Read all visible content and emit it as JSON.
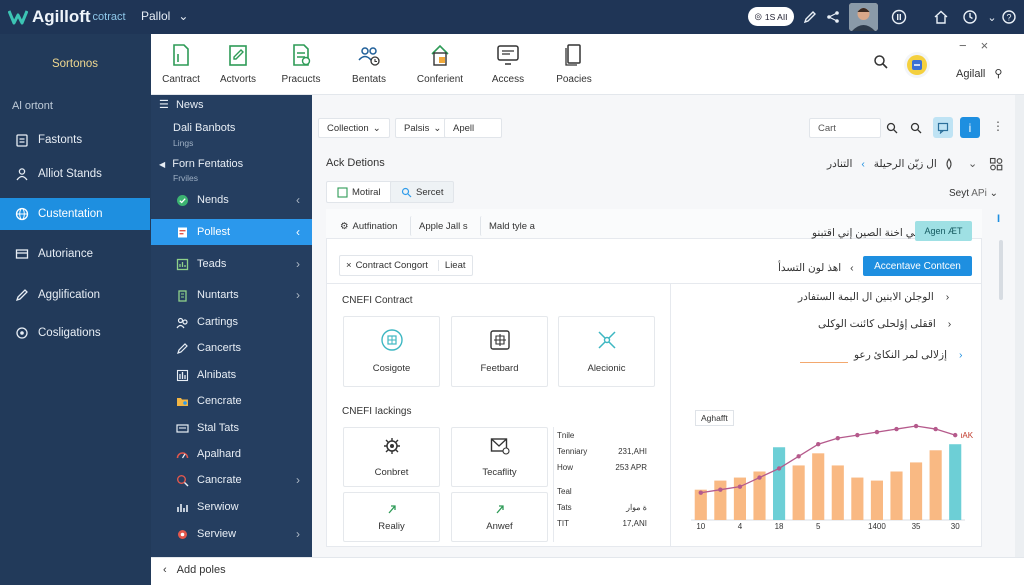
{
  "app": {
    "logo_text": "Agilloft",
    "logo_suffix": "cotract",
    "project": "Pallol",
    "pill": "1S AII",
    "user_label": "Agilall"
  },
  "left_nav": {
    "title": "Sortonos",
    "section": "Al ortont",
    "items": [
      {
        "label": "Fastonts",
        "icon": "clipboard-icon"
      },
      {
        "label": "Alliot Stands",
        "icon": "person-icon"
      },
      {
        "label": "Custentation",
        "icon": "globe-icon",
        "active": true
      },
      {
        "label": "Autoriance",
        "icon": "card-icon"
      },
      {
        "label": "Agglification",
        "icon": "pen-icon"
      },
      {
        "label": "Cosligations",
        "icon": "circle-icon"
      }
    ]
  },
  "ribbon": {
    "tabs": [
      {
        "label": "Cantract",
        "icon": "document-icon"
      },
      {
        "label": "Actvorts",
        "icon": "edit-document-icon"
      },
      {
        "label": "Pracucts",
        "icon": "doc-check-icon"
      },
      {
        "label": "Bentats",
        "icon": "users-clock-icon"
      },
      {
        "label": "Conferient",
        "icon": "doc-stamp-icon"
      },
      {
        "label": "Access",
        "icon": "monitor-icon"
      },
      {
        "label": "Poacies",
        "icon": "pages-icon"
      }
    ]
  },
  "sub_nav": {
    "header": "News",
    "groups": [
      {
        "title": "Dali Banbots",
        "sub": "Lings"
      },
      {
        "title": "Forn Fentatios",
        "sub": "Frviles"
      }
    ],
    "items": [
      {
        "label": "Nends"
      },
      {
        "label": "Pollest",
        "active": true
      },
      {
        "label": "Teads"
      },
      {
        "label": "Nuntarts"
      },
      {
        "label": "Cartings"
      },
      {
        "label": "Cancerts"
      },
      {
        "label": "Alnibats"
      },
      {
        "label": "Cencrate"
      },
      {
        "label": "Stal Tats"
      },
      {
        "label": "Apalhard"
      },
      {
        "label": "Cancrate"
      },
      {
        "label": "Serwiow"
      },
      {
        "label": "Serview"
      }
    ]
  },
  "toolbar": {
    "filter1": "Collection",
    "filter2": "Palsis",
    "filter3": "Apell",
    "search_placeholder": "Cart"
  },
  "main": {
    "heading": "Ack Detions",
    "rtl_breadcrumb1": "ال زيّن الرحيلة",
    "rtl_breadcrumb2": "التنادر",
    "btn_modal": "Motiral",
    "btn_search": "Sercet",
    "sort_label": "Seyt",
    "sort_value": "APi",
    "tabs": [
      "Autfination",
      "Apple Jall s",
      "Mald tyle a"
    ],
    "rtl_title": "افتي  اخنة الصين إني",
    "rtl_title_tail": "اقتبنو",
    "badge_teal": "Agen ÆT",
    "filter_tag": "Contract Congort",
    "filter_tag2": "Lieat",
    "rtl_mid": "اهذ لون التسدأ",
    "badge_blue": "Accentave Contcen",
    "section1": "CNEFI Contract",
    "tiles1": [
      {
        "label": "Cosigote",
        "icon": "grid-icon"
      },
      {
        "label": "Feetbard",
        "icon": "frame-icon"
      },
      {
        "label": "Alecionic",
        "icon": "network-icon"
      }
    ],
    "section2": "CNEFI Iackings",
    "tiles2": [
      {
        "label": "Conbret",
        "icon": "gear-icon"
      },
      {
        "label": "Tecaflity",
        "icon": "mail-icon"
      },
      {
        "label": "Realiy",
        "icon": "arrow-icon"
      },
      {
        "label": "Anwef",
        "icon": "arrow-icon"
      }
    ],
    "stats": [
      {
        "k": "Tnile",
        "v": ""
      },
      {
        "k": "Tenniary",
        "v": "231,AHI"
      },
      {
        "k": "How",
        "v": "253 APR"
      },
      {
        "k": "Teal",
        "v": ""
      },
      {
        "k": "Tats",
        "v": "ة موار"
      },
      {
        "k": "TIT",
        "v": "17,ANI"
      }
    ],
    "rtl_items": [
      "الوجلن الابنين ال البمة الستفادر",
      "اققلى إؤلحلى كائنت الوكلى",
      "إزلالى لمر النكائ رعو"
    ]
  },
  "chart_data": {
    "type": "bar",
    "title": "Aghafft",
    "marker_label": "ıAK",
    "x_ticks": [
      "10",
      "4",
      "18",
      "5",
      "1400",
      "35",
      "30"
    ],
    "values": [
      10,
      13,
      14,
      16,
      24,
      18,
      22,
      18,
      14,
      13,
      16,
      19,
      23,
      25
    ],
    "highlight": [
      false,
      false,
      false,
      false,
      true,
      false,
      false,
      false,
      false,
      false,
      false,
      false,
      false,
      true
    ],
    "line": [
      9,
      10,
      11,
      14,
      17,
      21,
      25,
      27,
      28,
      29,
      30,
      31,
      30,
      28
    ],
    "ylim": [
      0,
      32
    ],
    "colors": {
      "bar": "#f9b983",
      "highlight": "#6dcfd6",
      "line": "#b55a8c"
    }
  },
  "bottom_bar": {
    "label": "Add poles"
  }
}
